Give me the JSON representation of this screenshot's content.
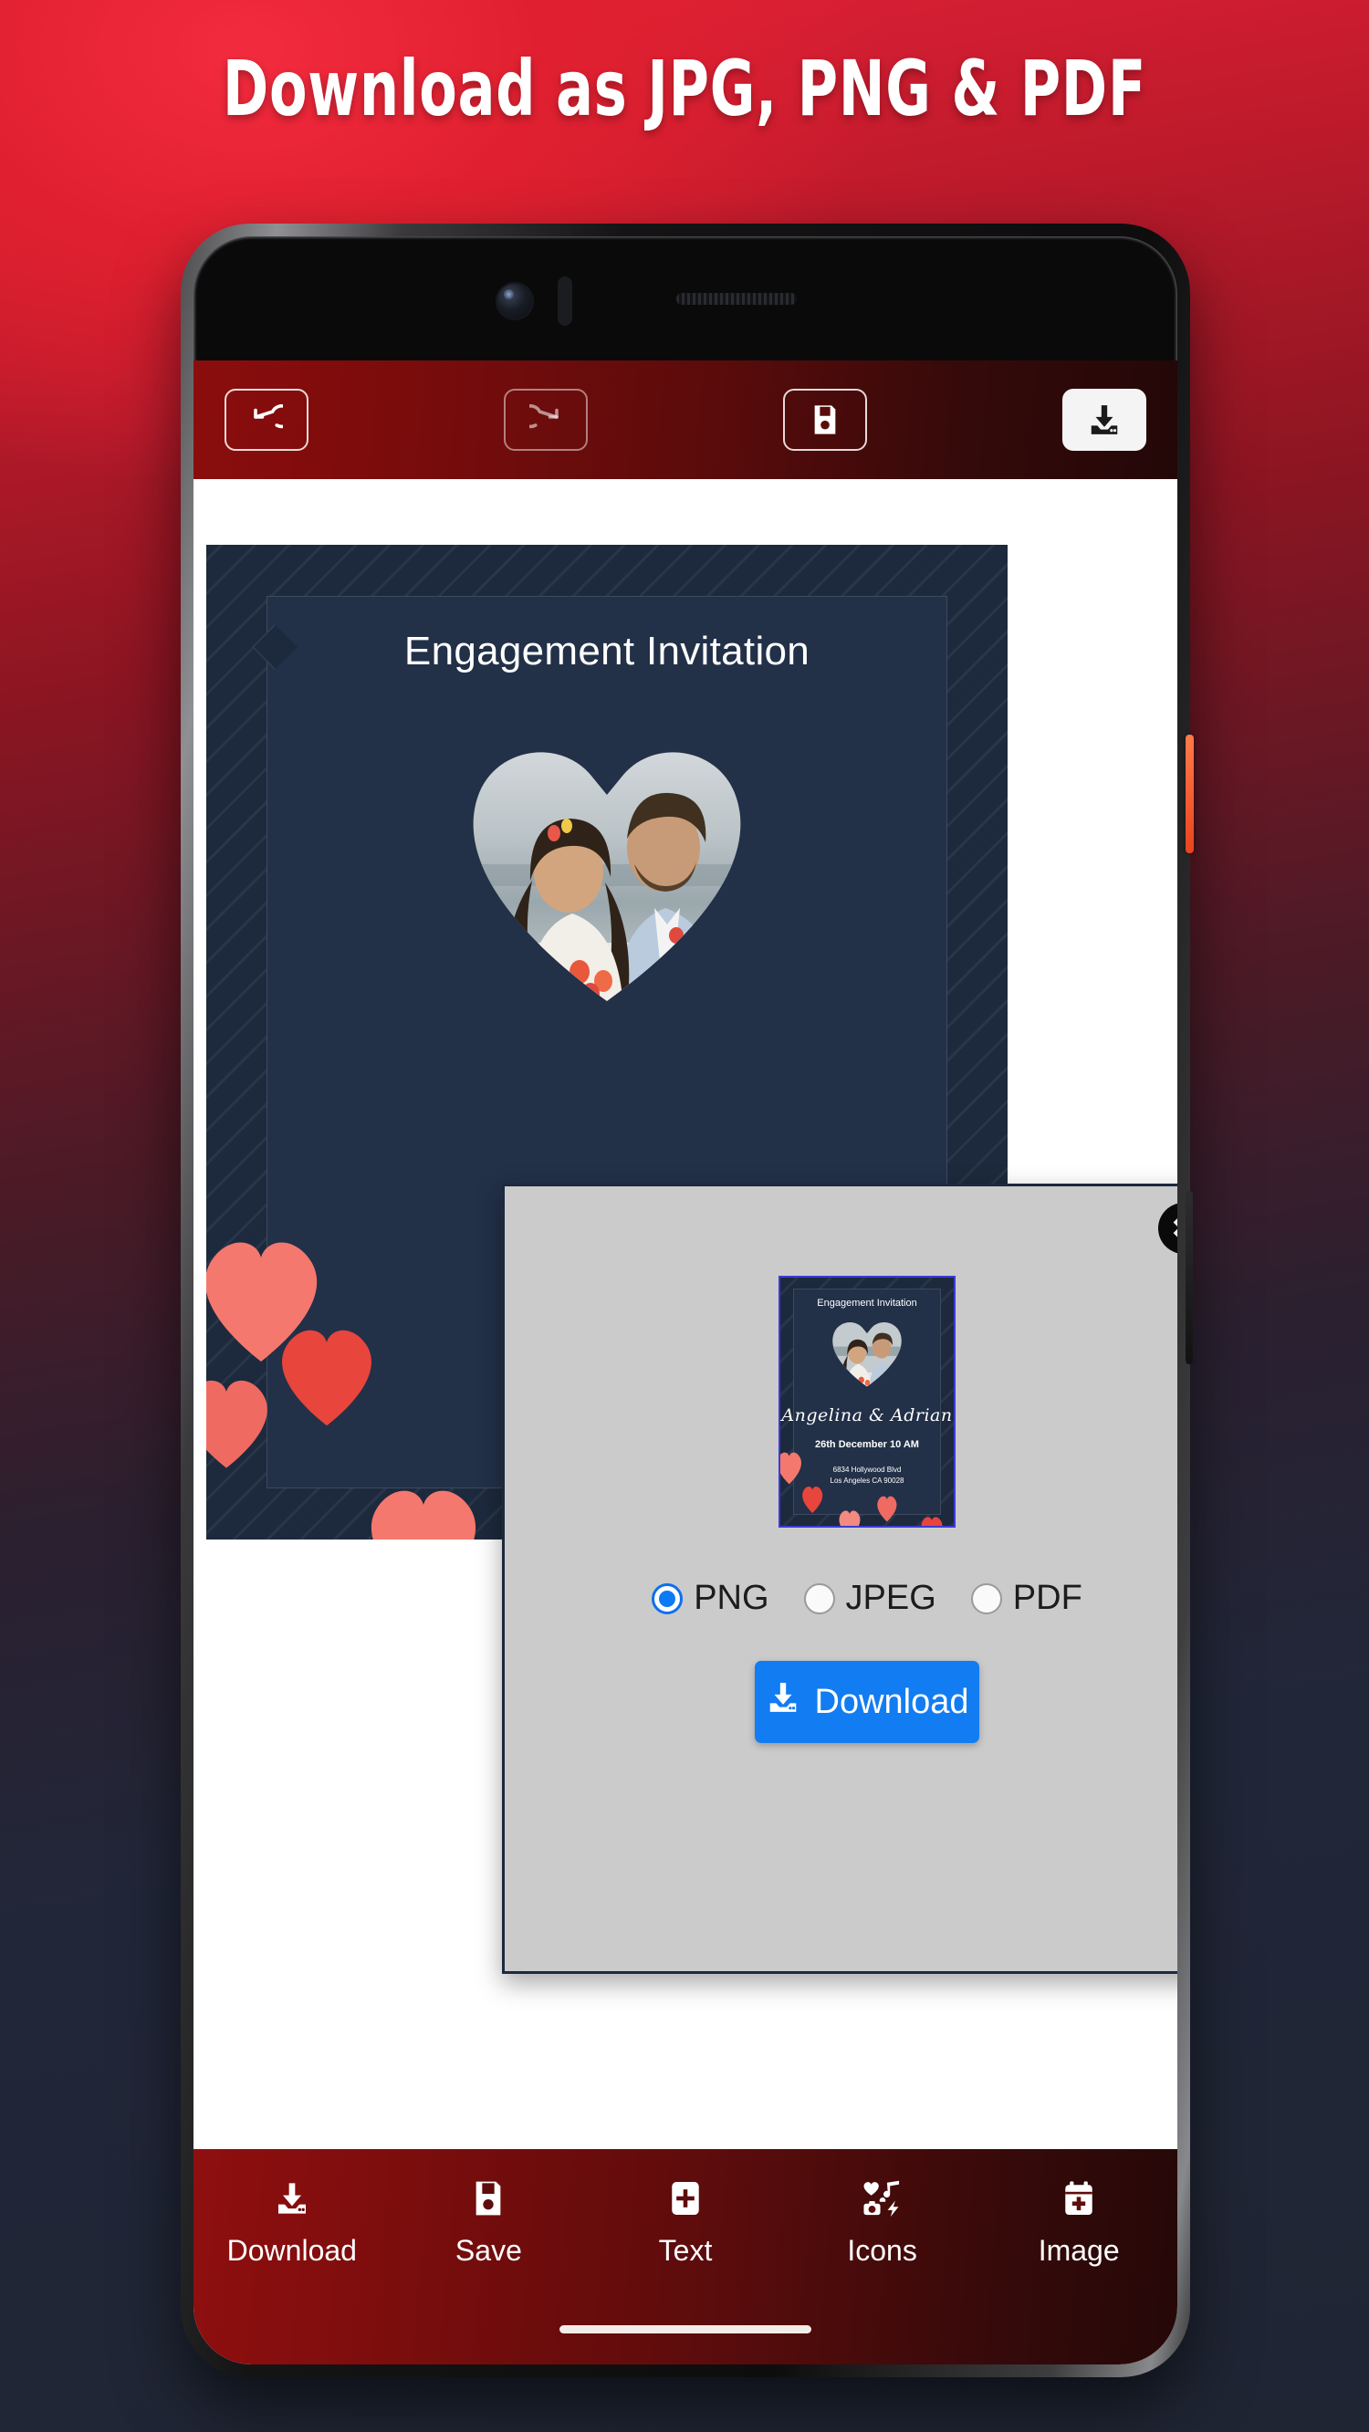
{
  "promo": {
    "headline": "Download as JPG, PNG & PDF"
  },
  "app": {
    "toolbar": {
      "undo": {
        "label": "Undo",
        "icon": "undo-icon"
      },
      "redo": {
        "label": "Redo",
        "icon": "redo-icon"
      },
      "save": {
        "label": "Save",
        "icon": "floppy-save-icon"
      },
      "download": {
        "label": "Download",
        "icon": "download-icon",
        "state": "active"
      }
    },
    "card": {
      "title": "Engagement Invitation",
      "names": "Angelina & Adrian",
      "date": "26th December 10 AM",
      "address_line1": "6834 Hollywood Blvd",
      "address_line2": "Los Angeles CA 90028",
      "photo_alt": "couple-photo-heart"
    },
    "modal": {
      "close_label": "✖",
      "preview": {
        "title": "Engagement Invitation",
        "names": "Angelina & Adrian",
        "date": "26th December 10 AM",
        "address_line1": "6834 Hollywood Blvd",
        "address_line2": "Los Angeles CA 90028"
      },
      "format_options": [
        {
          "label": "PNG",
          "selected": true
        },
        {
          "label": "JPEG",
          "selected": false
        },
        {
          "label": "PDF",
          "selected": false
        }
      ],
      "download_button": "Download"
    },
    "bottom_nav": [
      {
        "label": "Download",
        "icon": "download-icon"
      },
      {
        "label": "Save",
        "icon": "floppy-save-icon"
      },
      {
        "label": "Text",
        "icon": "text-add-icon"
      },
      {
        "label": "Icons",
        "icon": "stickers-icon"
      },
      {
        "label": "Image",
        "icon": "image-add-icon"
      }
    ]
  },
  "colors": {
    "promo_bg_red": "#e8213a",
    "promo_bg_navy": "#1f2533",
    "appbar_red": "#7a0c0c",
    "card_navy": "#1d293d",
    "card_inner_navy": "#223048",
    "heart_light": "#f4786d",
    "heart_dark": "#e8453c",
    "accent_blue": "#127cf2",
    "radio_blue": "#0c7bf5",
    "modal_gray": "#cbcbcb",
    "preview_border": "#3b3bd6",
    "power_button_orange": "#e8441f"
  }
}
